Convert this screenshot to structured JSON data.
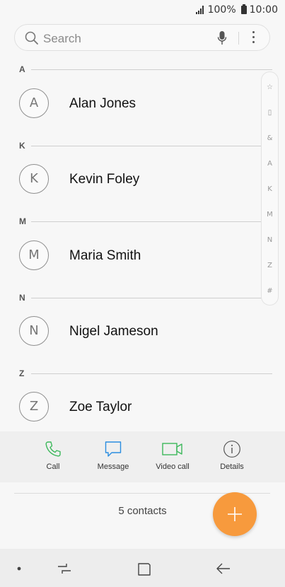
{
  "status_bar": {
    "battery": "100%",
    "time": "10:00"
  },
  "search": {
    "placeholder": "Search",
    "value": ""
  },
  "sections": [
    {
      "letter": "A",
      "contacts": [
        {
          "initial": "A",
          "name": "Alan Jones"
        }
      ]
    },
    {
      "letter": "K",
      "contacts": [
        {
          "initial": "K",
          "name": "Kevin Foley"
        }
      ]
    },
    {
      "letter": "M",
      "contacts": [
        {
          "initial": "M",
          "name": "Maria Smith"
        }
      ]
    },
    {
      "letter": "N",
      "contacts": [
        {
          "initial": "N",
          "name": "Nigel Jameson"
        }
      ]
    },
    {
      "letter": "Z",
      "contacts": [
        {
          "initial": "Z",
          "name": "Zoe Taylor"
        }
      ]
    }
  ],
  "index_bar": [
    "☆",
    "▯",
    "&",
    "A",
    "K",
    "M",
    "N",
    "Z",
    "#"
  ],
  "actions": [
    {
      "label": "Call",
      "icon": "phone-icon",
      "color": "#3cb85b"
    },
    {
      "label": "Message",
      "icon": "message-icon",
      "color": "#2a8de0"
    },
    {
      "label": "Video call",
      "icon": "video-call-icon",
      "color": "#3cb85b"
    },
    {
      "label": "Details",
      "icon": "info-icon",
      "color": "#555555"
    }
  ],
  "footer": {
    "count": "5 contacts"
  },
  "fab": {
    "icon": "plus-icon",
    "color": "#f79a3d"
  },
  "nav": {
    "icons": [
      "dot-icon",
      "recents-icon",
      "home-icon",
      "back-icon"
    ]
  }
}
